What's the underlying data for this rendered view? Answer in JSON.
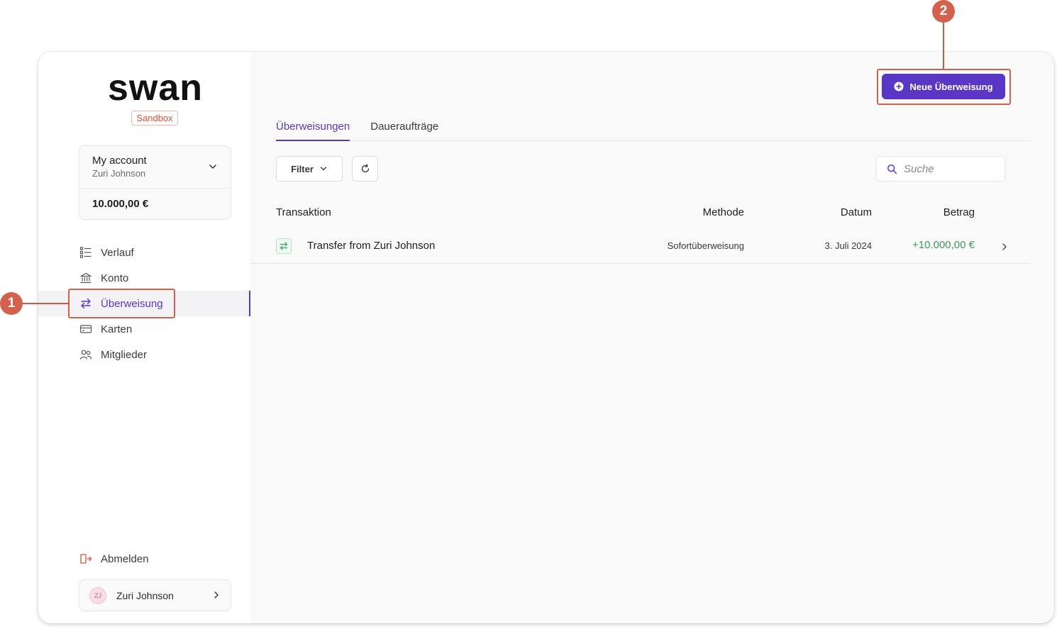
{
  "logo": {
    "text": "swan",
    "badge": "Sandbox"
  },
  "account": {
    "name": "My account",
    "holder": "Zuri Johnson",
    "balance": "10.000,00 €"
  },
  "nav": [
    {
      "label": "Verlauf",
      "icon": "history-list-icon"
    },
    {
      "label": "Konto",
      "icon": "bank-icon"
    },
    {
      "label": "Überweisung",
      "icon": "transfer-arrows-icon",
      "active": true
    },
    {
      "label": "Karten",
      "icon": "card-icon"
    },
    {
      "label": "Mitglieder",
      "icon": "members-icon"
    }
  ],
  "logout": {
    "label": "Abmelden"
  },
  "user": {
    "initials": "ZJ",
    "name": "Zuri Johnson"
  },
  "toolbar": {
    "new_transfer": "Neue Überweisung"
  },
  "tabs": [
    {
      "label": "Überweisungen",
      "active": true
    },
    {
      "label": "Daueraufträge",
      "active": false
    }
  ],
  "filter": {
    "label": "Filter"
  },
  "search": {
    "placeholder": "Suche"
  },
  "table": {
    "columns": [
      "Transaktion",
      "Methode",
      "Datum",
      "Betrag"
    ],
    "rows": [
      {
        "transaction": "Transfer from Zuri Johnson",
        "method": "Sofortüberweisung",
        "date": "3. Juli 2024",
        "amount": "+10.000,00 €"
      }
    ]
  },
  "callouts": [
    "1",
    "2"
  ],
  "colors": {
    "accent": "#5a36c4",
    "callout": "#d4604e",
    "positive": "#3e9a5a",
    "sandbox": "#d8503f"
  }
}
